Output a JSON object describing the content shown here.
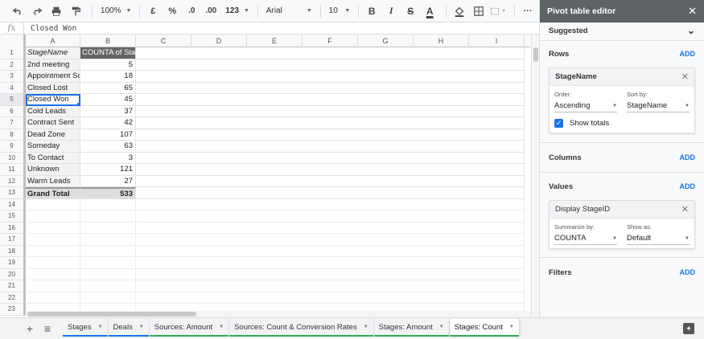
{
  "toolbar": {
    "zoom": "100%",
    "currency": "£",
    "percent": "%",
    "decrease_decimals": ".0",
    "increase_decimals": ".00",
    "more_formats": "123",
    "font": "Arial",
    "font_size": "10",
    "bold": "B",
    "italic": "I",
    "strikethrough": "S",
    "text_color": "A",
    "more": "···"
  },
  "formula_bar": {
    "fx": "fx",
    "value": "Closed Won"
  },
  "grid": {
    "columns": [
      "A",
      "B",
      "C",
      "D",
      "E",
      "F",
      "G",
      "H",
      "I"
    ],
    "header_row": {
      "row": "1",
      "a": "StageName",
      "b": "COUNTA of Stag"
    },
    "data_rows": [
      {
        "row": "2",
        "a": "2nd meeting",
        "b": "5"
      },
      {
        "row": "3",
        "a": "Appointment Sch",
        "b": "18"
      },
      {
        "row": "4",
        "a": "Closed Lost",
        "b": "65"
      },
      {
        "row": "5",
        "a": "Closed Won",
        "b": "45"
      },
      {
        "row": "6",
        "a": "Cold Leads",
        "b": "37"
      },
      {
        "row": "7",
        "a": "Contract Sent",
        "b": "42"
      },
      {
        "row": "8",
        "a": "Dead Zone",
        "b": "107"
      },
      {
        "row": "9",
        "a": "Someday",
        "b": "63"
      },
      {
        "row": "10",
        "a": "To Contact",
        "b": "3"
      },
      {
        "row": "11",
        "a": "Unknown",
        "b": "121"
      },
      {
        "row": "12",
        "a": "Warm Leads",
        "b": "27"
      }
    ],
    "total_row": {
      "row": "13",
      "a": "Grand Total",
      "b": "533"
    },
    "empty_rows": [
      "14",
      "15",
      "16",
      "17",
      "18",
      "19",
      "20",
      "21",
      "22",
      "23"
    ]
  },
  "sheet_tabs": {
    "add": "+",
    "list": "≡",
    "tabs": [
      {
        "label": "Stages",
        "color": "#1a73e8",
        "active": false
      },
      {
        "label": "Deals",
        "color": "#1a73e8",
        "active": false
      },
      {
        "label": "Sources: Amount",
        "color": "#34a853",
        "active": false
      },
      {
        "label": "Sources: Count & Conversion Rates",
        "color": "#34a853",
        "active": false
      },
      {
        "label": "Stages: Amount",
        "color": "#34a853",
        "active": false
      },
      {
        "label": "Stages: Count",
        "color": "#34a853",
        "active": true
      }
    ]
  },
  "panel": {
    "title": "Pivot table editor",
    "suggested": "Suggested",
    "rows": {
      "label": "Rows",
      "add": "ADD",
      "card": {
        "title": "StageName",
        "order_label": "Order:",
        "order_value": "Ascending",
        "sort_label": "Sort by:",
        "sort_value": "StageName",
        "totals_label": "Show totals"
      }
    },
    "columns": {
      "label": "Columns",
      "add": "ADD"
    },
    "values": {
      "label": "Values",
      "add": "ADD",
      "card": {
        "title": "Display StageID",
        "summarize_label": "Summarize by:",
        "summarize_value": "COUNTA",
        "show_as_label": "Show as:",
        "show_as_value": "Default"
      }
    },
    "filters": {
      "label": "Filters",
      "add": "ADD"
    }
  }
}
